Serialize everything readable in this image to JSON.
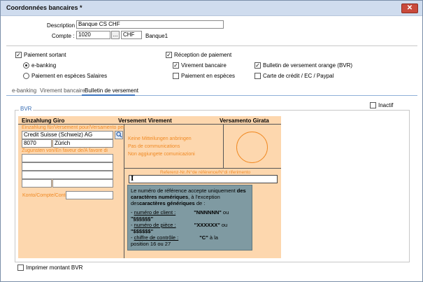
{
  "window": {
    "title": "Coordonnées bancaires *",
    "close_label": "✕"
  },
  "form": {
    "description_label": "Description :",
    "description_value": "Banque CS CHF",
    "compte_label": "Compte :",
    "compte_value": "1020",
    "dots_label": "...",
    "currency_value": "CHF",
    "bank_name": "Banque1"
  },
  "options": {
    "paiement_sortant": "Paiement sortant",
    "e_banking": "e-banking",
    "paiement_especes_salaires": "Paiement en espèces Salaires",
    "reception_paiement": "Réception de paiement",
    "virement_bancaire": "Virement bancaire",
    "paiement_especes": "Paiement en espèces",
    "bulletin_bvr": "Bulletin de versement orange (BVR)",
    "carte_credit": "Carte de crédit / EC / Paypal"
  },
  "tabs": [
    "e-banking",
    "Virement bancaire",
    "Bulletin de versement"
  ],
  "inactif_label": "Inactif",
  "bvr": {
    "group_title": "BVR",
    "head_de": "Einzahlung Giro",
    "head_fr": "Versement Virement",
    "head_it": "Versamento Girata",
    "einzahlung_label": "Einzahlung für/Versement pour/Versamento per",
    "bank_value": "Credit Suisse (Schweiz) AG",
    "zip_value": "8070",
    "city_value": "Zürich",
    "zugunsten_label": "Zugunsten von/En faveur de/A favore di",
    "konto_label": "Konto/Compte/Conto",
    "note1": "Keine Mitteilungen anbringen",
    "note2": "Pas de communications",
    "note3": "Non aggiungete comunicazioni",
    "reference_label": "Referenz-Nr./N°de référence/N°di riferimento",
    "cursor_glyph": "I"
  },
  "tooltip": {
    "l1a": "Le numéro de référence accepte uniquement ",
    "l1b": "des",
    "l2": "caractères numériques",
    "l2b": ", à l'exception",
    "l3a": "des",
    "l3b": "caractères génériques",
    "l3c": " de :",
    "i1a": "- ",
    "i1b": "numéro de client :",
    "i1c": "\"NNNNNN\"",
    "i1d": " ou",
    "i1e": "\"§§§§§§\"",
    "i2a": "- ",
    "i2b": "numéro de pièce :",
    "i2c": "\"XXXXXX\"",
    "i2d": " ou",
    "i2e": "\"$$$$$$\"",
    "i3a": "- ",
    "i3b": "chiffre de contrôle :",
    "i3c": "\"C\"",
    "i3d": " à la",
    "i3e": "position 16 ou 27"
  },
  "imprimer_label": "Imprimer montant BVR"
}
